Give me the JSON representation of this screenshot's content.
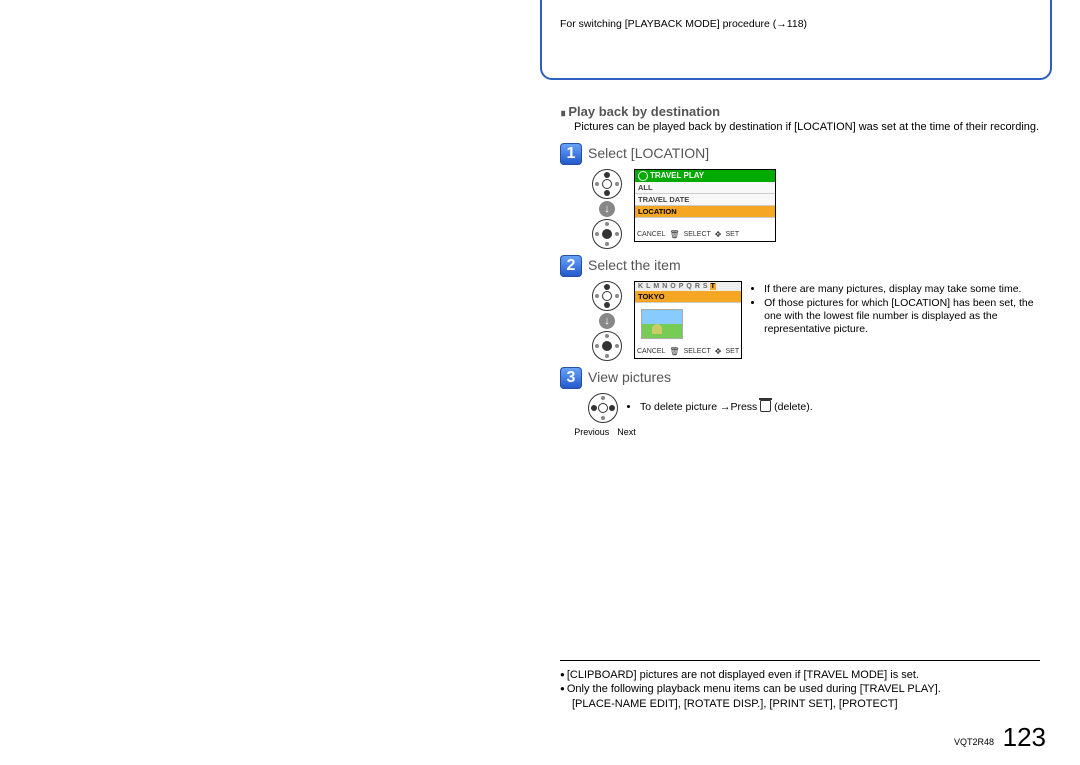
{
  "top_note": "For switching [PLAYBACK MODE] procedure (→118)",
  "section_heading": "Play back by destination",
  "intro": "Pictures can be played back by destination if [LOCATION] was set at the time of their recording.",
  "steps": {
    "s1": {
      "num": "1",
      "title": "Select [LOCATION]"
    },
    "s2": {
      "num": "2",
      "title": "Select the item"
    },
    "s3": {
      "num": "3",
      "title": "View pictures"
    }
  },
  "screen1": {
    "header": "TRAVEL PLAY",
    "r1": "ALL",
    "r2": "TRAVEL DATE",
    "r3": "LOCATION",
    "footer_cancel": "CANCEL",
    "footer_select": "SELECT",
    "footer_set": "SET"
  },
  "screen2": {
    "alpha": [
      "K",
      "L",
      "M",
      "N",
      "O",
      "P",
      "Q",
      "R",
      "S",
      "T"
    ],
    "sel": "TOKYO",
    "footer_cancel": "CANCEL",
    "footer_select": "SELECT",
    "footer_set": "SET"
  },
  "step2_notes": {
    "n1": "If there are many pictures, display may take some time.",
    "n2": "Of those pictures for which [LOCATION] has been set, the one with the lowest file number is displayed as the representative picture."
  },
  "step3_note": "To delete picture →Press ",
  "step3_note_tail": " (delete).",
  "prev": "Previous",
  "next": "Next",
  "footnotes": {
    "f1": "[CLIPBOARD] pictures are not displayed even if [TRAVEL MODE] is set.",
    "f2": "Only the following playback menu items can be used during [TRAVEL PLAY].",
    "f2b": "[PLACE-NAME EDIT], [ROTATE DISP.], [PRINT SET], [PROTECT]"
  },
  "doc_code": "VQT2R48",
  "page_number": "123"
}
